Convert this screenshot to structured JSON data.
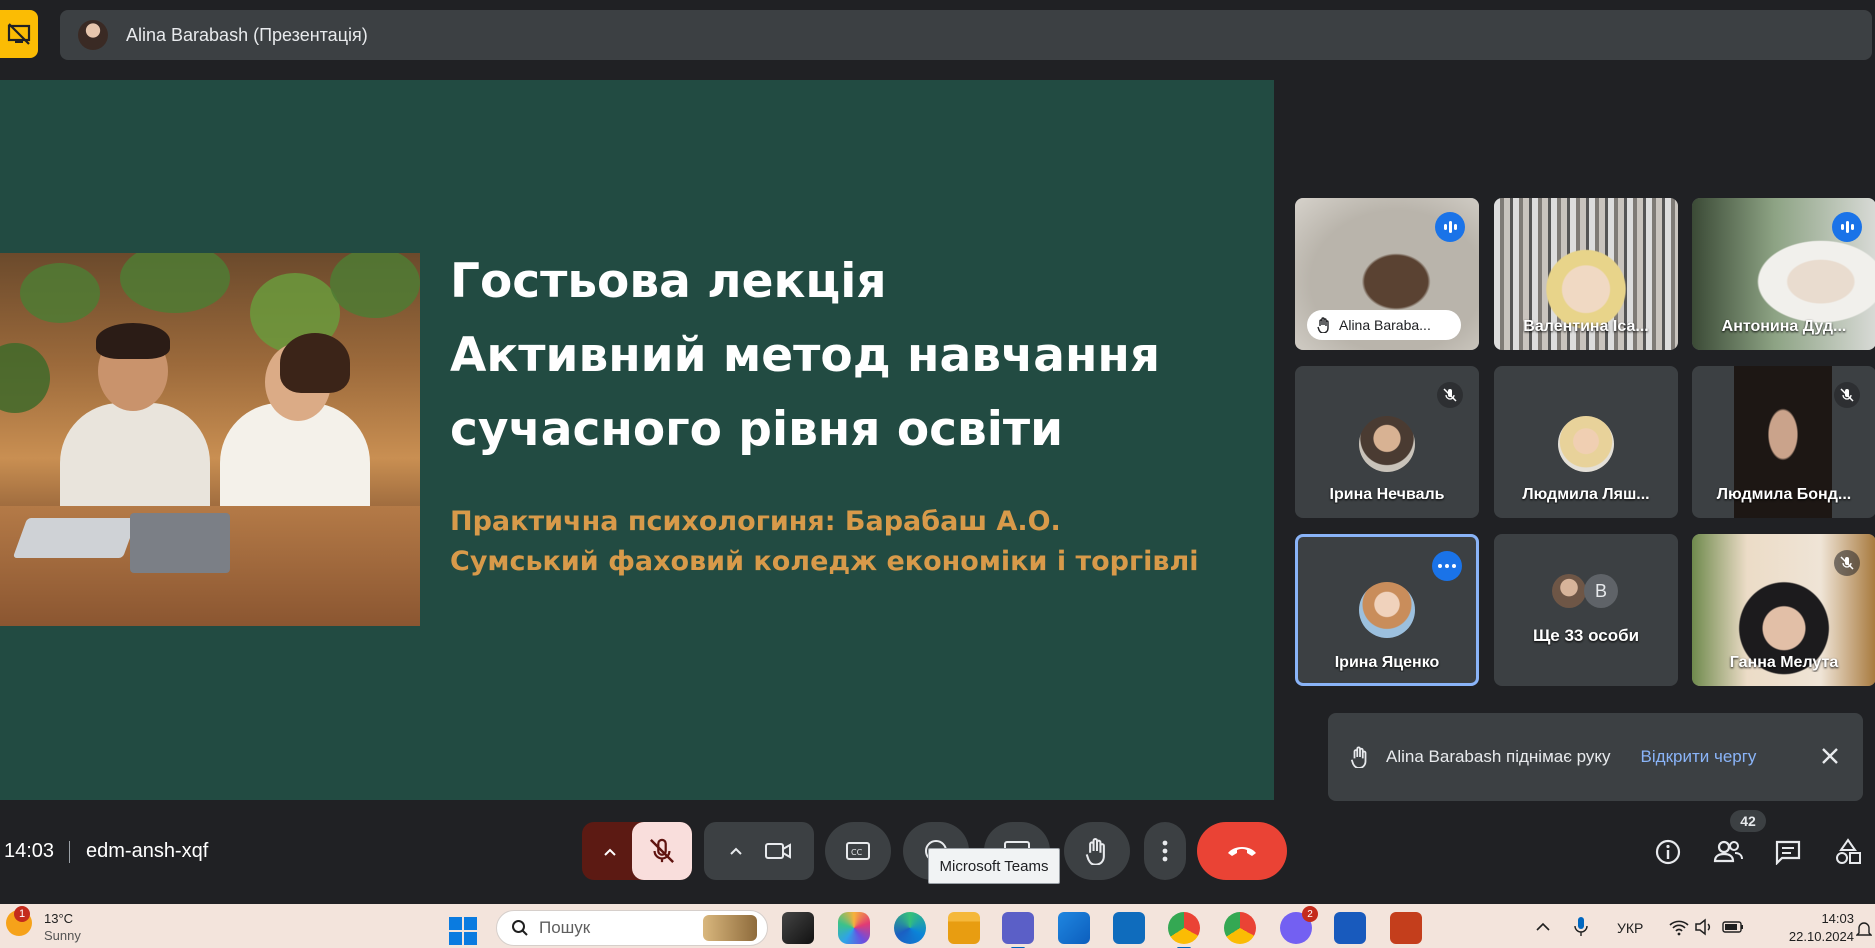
{
  "presenter_bar": {
    "name": "Alina Barabash (Презентація)"
  },
  "slide": {
    "title_lines": [
      "Гостьова лекція",
      "Активний метод навчання",
      "сучасного рівня освіти"
    ],
    "subtitle_lines": [
      "Практична психологиня:  Барабаш А.О.",
      "Сумський фаховий коледж економіки і торгівлі"
    ]
  },
  "participants": [
    {
      "name": "Alina Baraba...",
      "state": "speaking, hand raised"
    },
    {
      "name": "Валентина Іса...",
      "state": "video"
    },
    {
      "name": "Антонина Дуд...",
      "state": "speaking"
    },
    {
      "name": "Ірина Нечваль",
      "state": "muted"
    },
    {
      "name": "Людмила Ляш...",
      "state": "avatar"
    },
    {
      "name": "Людмила Бонд...",
      "state": "muted"
    },
    {
      "name": "Ірина Яценко",
      "state": "pinned"
    },
    {
      "name": "Ще 33 особи",
      "initial": "В"
    },
    {
      "name": "Ганна Мелута",
      "state": "muted"
    }
  ],
  "toast": {
    "message": "Alina Barabash піднімає руку",
    "action": "Відкрити чергу"
  },
  "controls": {
    "time": "14:03",
    "meeting_code": "edm-ansh-xqf",
    "tooltip": "Microsoft Teams",
    "people_count": "42"
  },
  "taskbar": {
    "weather_badge": "1",
    "temperature": "13°C",
    "condition": "Sunny",
    "search_placeholder": "Пошук",
    "chrome_badge": "2",
    "language": "УКР",
    "clock_time": "14:03",
    "clock_date": "22.10.2024"
  },
  "colors": {
    "slide_bg": "#224b42",
    "slide_subtitle": "#d89a4a",
    "accent_blue": "#1a73e8",
    "leave_red": "#ea4335",
    "stop_share_yellow": "#fbbc04"
  }
}
